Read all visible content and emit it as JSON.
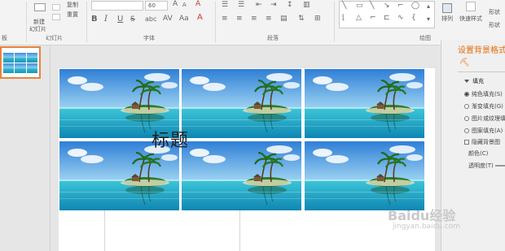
{
  "ribbon": {
    "top_partial": [
      "复制",
      "重置"
    ],
    "new_slide_label_1": "新建",
    "new_slide_label_2": "幻灯片",
    "font_size": "60",
    "groups": {
      "clipboard": "板",
      "slides": "幻灯片",
      "font": "字体",
      "paragraph": "段落",
      "drawing": "绘图"
    },
    "arrange_label": "排列",
    "quick_styles_label": "快速样式",
    "right_partial": [
      "形状",
      "形状"
    ],
    "font_buttons": [
      "B",
      "I",
      "U",
      "S"
    ]
  },
  "thumbnails": {
    "slide_number": "1"
  },
  "slide": {
    "title_placeholder": "标题",
    "images": [
      "tropical-island-image",
      "tropical-island-image",
      "tropical-island-image",
      "tropical-island-image",
      "tropical-island-image",
      "tropical-island-image"
    ]
  },
  "format_pane": {
    "title": "设置背景格式",
    "section": "填充",
    "options": [
      {
        "label": "纯色填充(S)",
        "selected": true
      },
      {
        "label": "渐变填充(G)",
        "selected": false
      },
      {
        "label": "图片或纹理填",
        "selected": false
      },
      {
        "label": "图案填充(A)",
        "selected": false
      }
    ],
    "hide_bg_label": "隐藏背景图",
    "color_label": "颜色(C)",
    "transparency_label": "透明度(T)"
  },
  "watermark": {
    "brand": "Baidu经验",
    "url": "jingyan.baidu.com"
  }
}
